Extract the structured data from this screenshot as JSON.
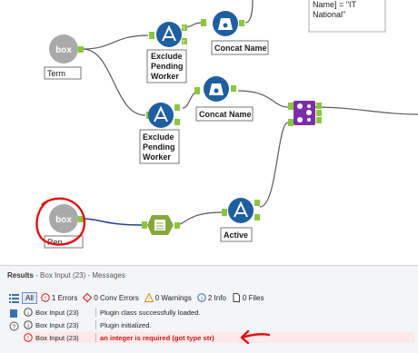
{
  "canvas": {
    "top_text": [
      "Name] = \"IT",
      "National\""
    ],
    "labels": {
      "term": "Term",
      "concat1": "Concat Name",
      "exclude1": [
        "Exclude",
        "Pending",
        "Worker"
      ],
      "concat2": "Concat Name",
      "exclude2": [
        "Exclude",
        "Pending",
        "Worker"
      ],
      "renamed": "Ren...",
      "active": "Active"
    },
    "box_icon_text": "box",
    "anchors": {
      "t": "T",
      "f": "F",
      "l": "L",
      "j": "J",
      "r": "R"
    }
  },
  "results": {
    "title": "Results",
    "subtitle": "- Box Input (23) - Messages",
    "filters": {
      "all": "All",
      "errors": "1 Errors",
      "conv_errors": "0 Conv Errors",
      "warnings": "0 Warnings",
      "info": "2 Info",
      "files": "0 Files"
    },
    "rows": [
      {
        "tool": "Box Input (23)",
        "message": "Plugin class successfully loaded."
      },
      {
        "tool": "Box Input (23)",
        "message": "Plugin initialized."
      },
      {
        "tool": "Box Input (23)",
        "message": "an integer is required (got type str)"
      }
    ]
  },
  "colors": {
    "filter_tool": "#1f5fa0",
    "formula_tool": "#1f5fa0",
    "join_tool": "#7b2fa8",
    "box_tool": "#a9a9a9",
    "text_input_tool": "#86a83a",
    "anchor_green": "#8dc63f",
    "connector": "#5a5a5a",
    "selected_connector": "#2a3d8a",
    "annotation_red": "#e01010"
  }
}
